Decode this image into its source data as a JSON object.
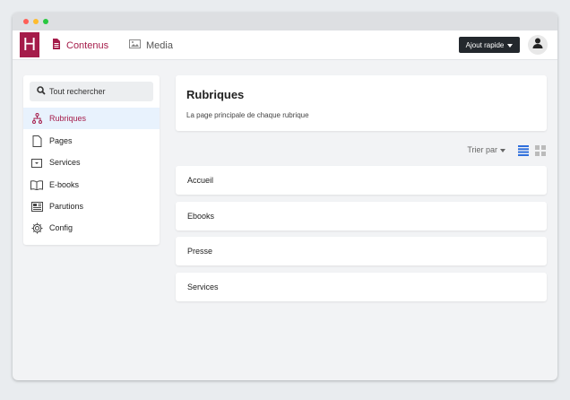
{
  "colors": {
    "brand": "#a51c4a",
    "active_bg": "#e8f2fd",
    "accent_blue": "#2f6fdc",
    "dark_button": "#23282d"
  },
  "logo": {
    "letter": "H"
  },
  "nav": {
    "tabs": [
      {
        "label": "Contenus",
        "icon": "document-icon",
        "active": true
      },
      {
        "label": "Media",
        "icon": "image-icon",
        "active": false
      }
    ],
    "quick_add_label": "Ajout rapide",
    "avatar_icon": "user-icon"
  },
  "sidebar": {
    "search_placeholder": "Tout rechercher",
    "items": [
      {
        "label": "Rubriques",
        "icon": "sitemap-icon",
        "active": true
      },
      {
        "label": "Pages",
        "icon": "page-icon",
        "active": false
      },
      {
        "label": "Services",
        "icon": "bag-icon",
        "active": false
      },
      {
        "label": "E-books",
        "icon": "book-icon",
        "active": false
      },
      {
        "label": "Parutions",
        "icon": "newspaper-icon",
        "active": false
      },
      {
        "label": "Config",
        "icon": "gear-icon",
        "active": false
      }
    ]
  },
  "main": {
    "title": "Rubriques",
    "subtitle": "La page principale de chaque rubrique",
    "sort_label": "Trier par",
    "rows": [
      "Accueil",
      "Ebooks",
      "Presse",
      "Services"
    ]
  }
}
